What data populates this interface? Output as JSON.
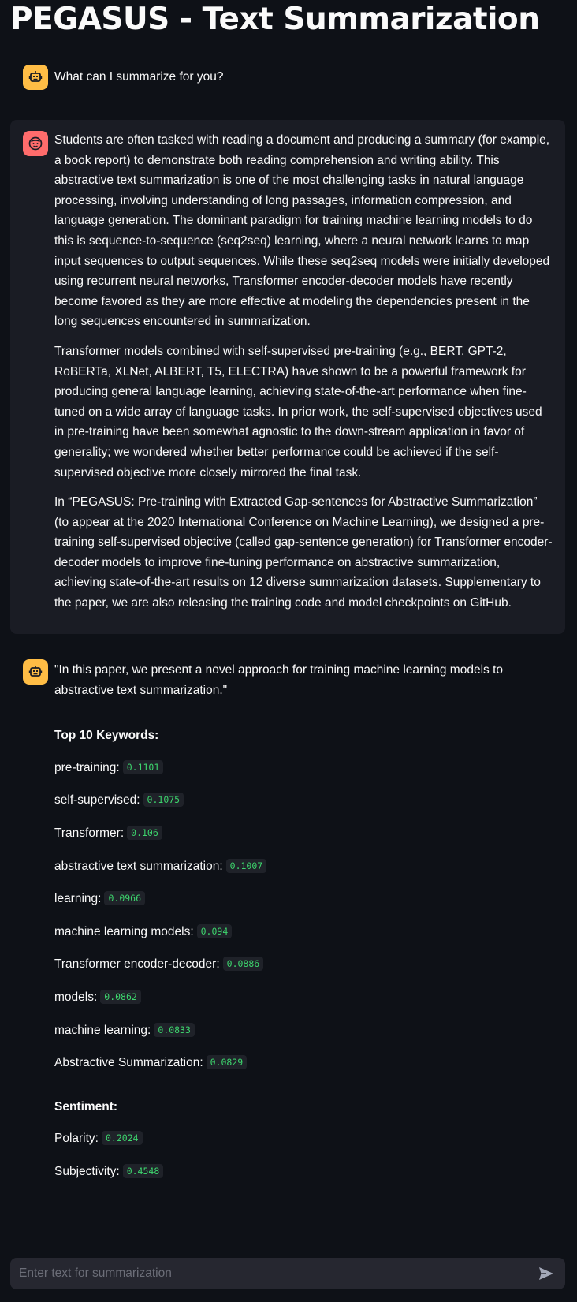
{
  "page": {
    "title": "PEGASUS - Text Summarization"
  },
  "messages": [
    {
      "role": "assistant",
      "avatar_icon": "robot-icon",
      "text": "What can I summarize for you?"
    },
    {
      "role": "user",
      "avatar_icon": "smiley-face-icon",
      "paragraphs": [
        "Students are often tasked with reading a document and producing a summary (for example, a book report) to demonstrate both reading comprehension and writing ability. This abstractive text summarization is one of the most challenging tasks in natural language processing, involving understanding of long passages, information compression, and language generation. The dominant paradigm for training machine learning models to do this is sequence-to-sequence (seq2seq) learning, where a neural network learns to map input sequences to output sequences. While these seq2seq models were initially developed using recurrent neural networks, Transformer encoder-decoder models have recently become favored as they are more effective at modeling the dependencies present in the long sequences encountered in summarization.",
        "Transformer models combined with self-supervised pre-training (e.g., BERT, GPT-2, RoBERTa, XLNet, ALBERT, T5, ELECTRA) have shown to be a powerful framework for producing general language learning, achieving state-of-the-art performance when fine-tuned on a wide array of language tasks. In prior work, the self-supervised objectives used in pre-training have been somewhat agnostic to the down-stream application in favor of generality; we wondered whether better performance could be achieved if the self-supervised objective more closely mirrored the final task.",
        "In “PEGASUS: Pre-training with Extracted Gap-sentences for Abstractive Summarization” (to appear at the 2020 International Conference on Machine Learning), we designed a pre-training self-supervised objective (called gap-sentence generation) for Transformer encoder-decoder models to improve fine-tuning performance on abstractive summarization, achieving state-of-the-art results on 12 diverse summarization datasets. Supplementary to the paper, we are also releasing the training code and model checkpoints on GitHub."
      ]
    },
    {
      "role": "assistant",
      "avatar_icon": "robot-icon",
      "summary": "\"In this paper, we present a novel approach for training machine learning models to abstractive text summarization.\"",
      "keywords_heading": "Top 10 Keywords:",
      "keywords": [
        {
          "term": "pre-training:",
          "score": "0.1101"
        },
        {
          "term": "self-supervised:",
          "score": "0.1075"
        },
        {
          "term": "Transformer:",
          "score": "0.106"
        },
        {
          "term": "abstractive text summarization:",
          "score": "0.1007"
        },
        {
          "term": "learning:",
          "score": "0.0966"
        },
        {
          "term": "machine learning models:",
          "score": "0.094"
        },
        {
          "term": "Transformer encoder-decoder:",
          "score": "0.0886"
        },
        {
          "term": "models:",
          "score": "0.0862"
        },
        {
          "term": "machine learning:",
          "score": "0.0833"
        },
        {
          "term": "Abstractive Summarization:",
          "score": "0.0829"
        }
      ],
      "sentiment_heading": "Sentiment:",
      "sentiment": {
        "polarity_label": "Polarity:",
        "polarity": "0.2024",
        "subjectivity_label": "Subjectivity:",
        "subjectivity": "0.4548"
      }
    }
  ],
  "chat_input": {
    "placeholder": "Enter text for summarization",
    "send_icon": "send-icon"
  },
  "colors": {
    "background": "#0e1117",
    "user_message_bg": "#1a1c24",
    "bot_avatar": "#ffbd45",
    "user_avatar": "#ff6c6c",
    "score_text": "#3dd56d",
    "input_bg": "#262730"
  }
}
